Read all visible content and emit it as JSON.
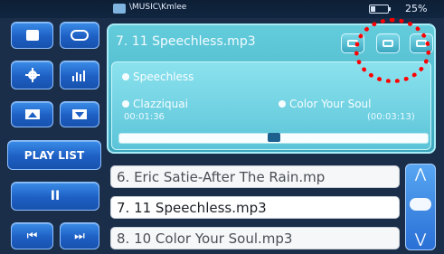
{
  "status": {
    "path": "\\MUSIC\\Kmlee",
    "battery_text": "25%",
    "battery_level": 0.25
  },
  "left_pad": {
    "playlist_label": "PLAY LIST"
  },
  "now_playing": {
    "title": "7. 11 Speechless.mp3",
    "song": "Speechless",
    "artist": "Clazziquai",
    "album": "Color Your Soul",
    "elapsed": "00:01:36",
    "total": "(00:03:13)",
    "progress": 0.5
  },
  "playlist": {
    "items": [
      "6. Eric Satie-After The Rain.mp",
      "7. 11 Speechless.mp3",
      "8. 10 Color Your Soul.mp3"
    ],
    "current_index": 1,
    "up_glyph": "⋀",
    "down_glyph": "⋁"
  },
  "controls": {
    "pause_glyph": "II",
    "prev_glyph": "⏮",
    "next_glyph": "⏭"
  },
  "colors": {
    "annotation": "#ff0000",
    "panel": "#4fbcd0",
    "button": "#1e5fc4"
  }
}
